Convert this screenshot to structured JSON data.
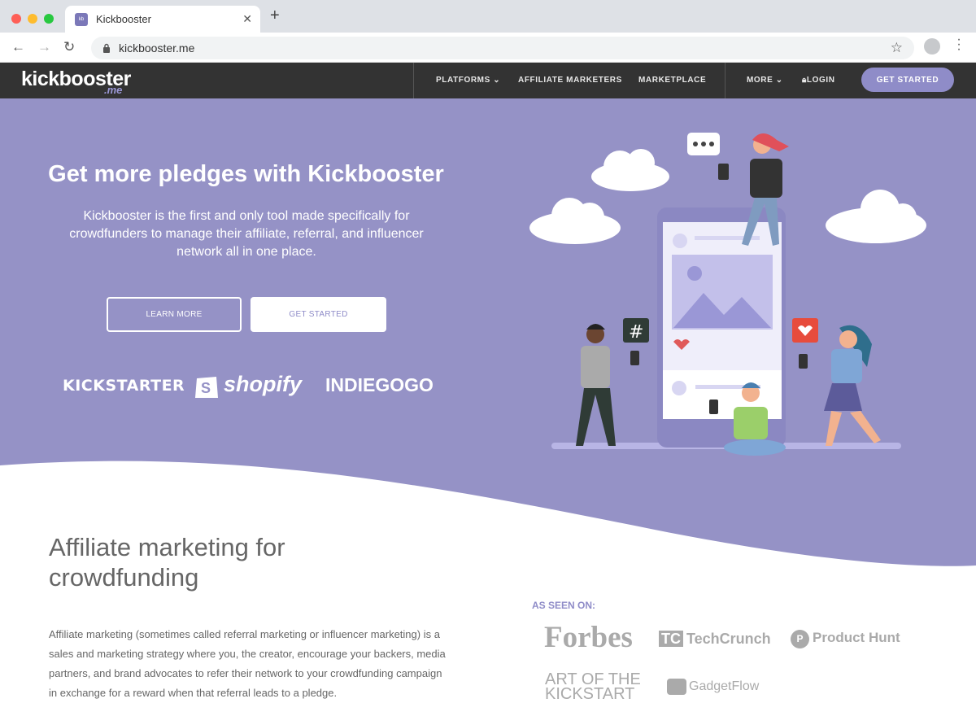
{
  "browser": {
    "tab_title": "Kickbooster",
    "url": "kickbooster.me"
  },
  "header": {
    "logo_main": "kickbooster",
    "logo_sub": ".me",
    "nav": {
      "platforms": "PLATFORMS",
      "affiliate": "AFFILIATE MARKETERS",
      "marketplace": "MARKETPLACE",
      "more": "MORE",
      "login": "LOGIN",
      "get_started": "GET STARTED"
    }
  },
  "hero": {
    "title": "Get more pledges with Kickbooster",
    "text": "Kickbooster is the first and only tool made specifically for crowdfunders to manage their affiliate, referral, and influencer network all in one place.",
    "learn_more": "LEARN MORE",
    "get_started": "GET STARTED",
    "platforms": [
      "KICKSTARTER",
      "shopify",
      "INDIEGOGO"
    ]
  },
  "section": {
    "title": "Affiliate marketing for crowdfunding",
    "text": "Affiliate marketing (sometimes called referral marketing or influencer marketing) is a sales and marketing strategy where you, the creator, encourage your backers, media partners, and brand advocates to refer their network to your crowdfunding campaign in exchange for a reward when that referral leads to a pledge."
  },
  "press": {
    "label": "AS SEEN ON:",
    "outlets": [
      "Forbes",
      "TechCrunch",
      "Product Hunt",
      "ART OF THE KICKSTART",
      "GadgetFlow"
    ]
  },
  "colors": {
    "brand_purple": "#9592c6",
    "header_dark": "#333333",
    "accent": "#8f8cc8"
  }
}
